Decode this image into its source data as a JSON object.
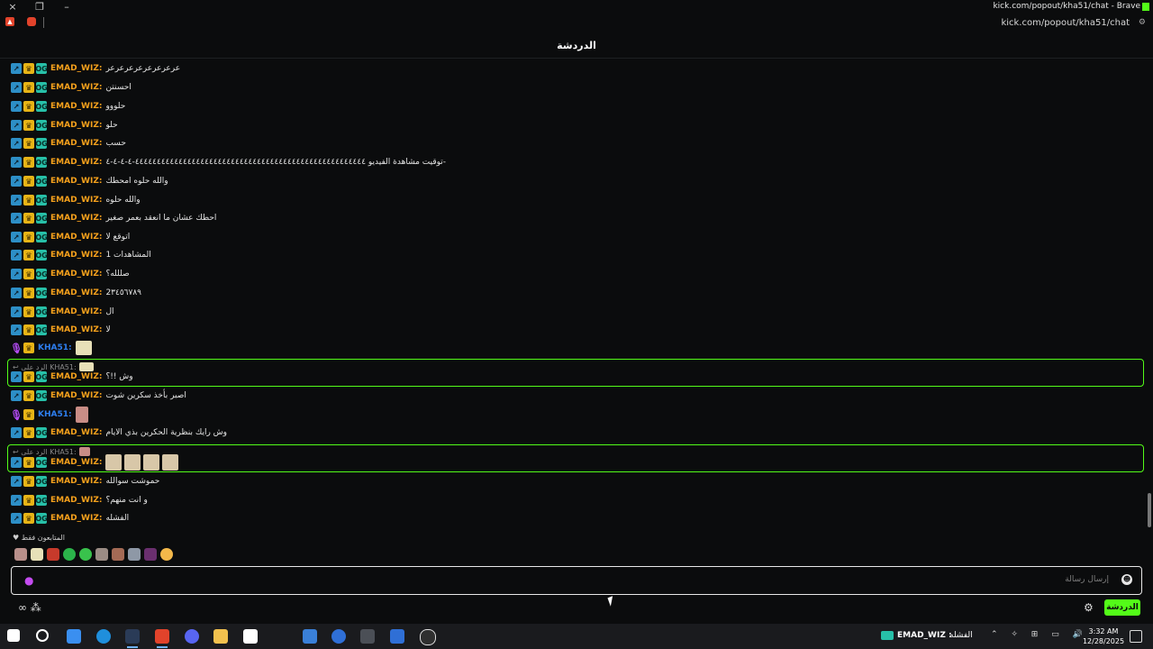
{
  "window": {
    "title": "kick.com/popout/kha51/chat - Brave",
    "url": "kick.com/popout/kha51/chat",
    "controls": [
      "×",
      "❐",
      "–"
    ]
  },
  "chat": {
    "title": "الدردشة",
    "messages": [
      {
        "user": "EMAD_WIZ",
        "text": "عرعرعرعرعرعرعرعر"
      },
      {
        "user": "EMAD_WIZ",
        "text": "احسنتن"
      },
      {
        "user": "EMAD_WIZ",
        "text": "حلووو"
      },
      {
        "user": "EMAD_WIZ",
        "text": "حلو"
      },
      {
        "user": "EMAD_WIZ",
        "text": "حسب"
      },
      {
        "user": "EMAD_WIZ",
        "text": "توقيت مشاهدة الفيديو ٤٤٤٤٤٤٤٤٤٤٤٤٤٤٤٤٤٤٤٤٤٤٤٤٤٤٤٤٤٤٤٤٤٤٤٤٤٤٤٤٤٤٤٤٤٤٤٤٤٤٤٤٤-٤-٤-٤-٤-"
      },
      {
        "user": "EMAD_WIZ",
        "text": "والله حلوه امحطك"
      },
      {
        "user": "EMAD_WIZ",
        "text": "والله حلوه"
      },
      {
        "user": "EMAD_WIZ",
        "text": "احطك عشان ما انعقد بعمر صغير"
      },
      {
        "user": "EMAD_WIZ",
        "text": "اتوقع لا"
      },
      {
        "user": "EMAD_WIZ",
        "text": "المشاهدات 1"
      },
      {
        "user": "EMAD_WIZ",
        "text": "صللله؟"
      },
      {
        "user": "EMAD_WIZ",
        "text": "2٣٤٥٦٧٨٩"
      },
      {
        "user": "EMAD_WIZ",
        "text": "ال"
      },
      {
        "user": "EMAD_WIZ",
        "text": "لا"
      },
      {
        "user": "KHA51",
        "text": ""
      },
      {
        "user": "EMAD_WIZ",
        "text": "وش !!؟",
        "reply_to": "الرد على KHA51:"
      },
      {
        "user": "EMAD_WIZ",
        "text": "اصبر بأخذ سكرين شوت"
      },
      {
        "user": "KHA51",
        "text": ""
      },
      {
        "user": "EMAD_WIZ",
        "text": "وش رايك بنظرية الحكرين بذي الايام"
      },
      {
        "user": "EMAD_WIZ",
        "text": "",
        "reply_to": "الرد على KHA51:"
      },
      {
        "user": "EMAD_WIZ",
        "text": "حموشت سوالله"
      },
      {
        "user": "EMAD_WIZ",
        "text": "و انت منهم؟"
      },
      {
        "user": "EMAD_WIZ",
        "text": "الفشله"
      }
    ],
    "followers_label": "المتابعون فقط",
    "input_placeholder": "إرسال رسالة",
    "send_button": "الدردشة"
  },
  "taskbar": {
    "tray_user": "EMAD_WIZ :",
    "tray_message": "الفشله",
    "time": "3:32 AM",
    "date": "12/28/2025"
  },
  "colors": {
    "accent": "#53fc18",
    "emad_name": "#f6a11c",
    "kha_name": "#2e7ff0",
    "background": "#0b0c0d"
  }
}
